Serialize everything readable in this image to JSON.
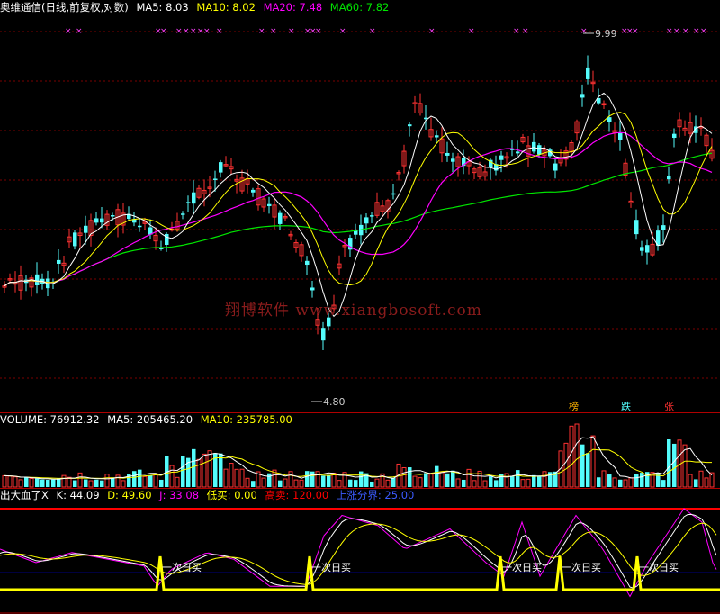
{
  "header": {
    "title": "奥维通信(日线,前复权,对数)",
    "ma5": "MA5: 8.03",
    "ma10": "MA10: 8.02",
    "ma20": "MA20: 7.48",
    "ma60": "MA60: 7.82"
  },
  "volume_header": {
    "volume": "VOLUME: 76912.32",
    "ma5": "MA5: 205465.20",
    "ma10": "MA10: 235785.00"
  },
  "indicator_header": {
    "name": "出大血了X",
    "k": "K: 44.09",
    "d": "D: 49.60",
    "j": "J: 33.08",
    "low_buy": "低买: 0.00",
    "high_sell": "高卖: 120.00",
    "boundary": "上涨分界: 25.00"
  },
  "labels": {
    "max_price": "9.99",
    "min_price": "4.80",
    "watermark": "翔博软件 www.xiangbosoft.com",
    "tag_bang": "榜",
    "tag_die": "跌",
    "tag_zhang": "张",
    "signal": "一次日买"
  },
  "colors": {
    "up": "#ff3232",
    "down": "#54fcfc",
    "ma5": "#ffffff",
    "ma10": "#ffff00",
    "ma20": "#ff00ff",
    "ma60": "#00e600",
    "k": "#ffffff",
    "d": "#ffff00",
    "j": "#ff00ff",
    "low_buy": "#ffff00",
    "high_sell": "#ff0000",
    "boundary": "#0000ff"
  },
  "chart_data": {
    "type": "candlestick",
    "price_axis": "log",
    "annotated_high": 9.99,
    "annotated_low": 4.8,
    "last_values": {
      "ma5": 8.03,
      "ma10": 8.02,
      "ma20": 7.48,
      "ma60": 7.82,
      "volume": 76912.32,
      "vol_ma5": 205465.2,
      "vol_ma10": 235785.0,
      "k": 44.09,
      "d": 49.6,
      "j": 33.08
    },
    "thresholds": {
      "low_buy": 0,
      "high_sell": 120,
      "boundary": 25
    },
    "signal_count": 5
  }
}
